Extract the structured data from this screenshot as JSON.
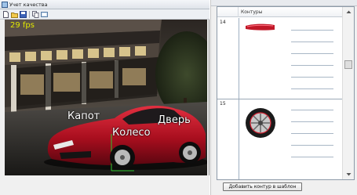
{
  "window": {
    "title": "Учет качества",
    "toolbar": [
      "new-file-icon",
      "open-folder-icon",
      "save-icon",
      "copy-icon",
      "settings-icon"
    ]
  },
  "viewport": {
    "fps": "29 fps",
    "labels": {
      "hood": "Капот",
      "door": "Дверь",
      "wheel": "Колесо"
    }
  },
  "panel": {
    "columns": [
      "",
      "Контуры"
    ],
    "rows": [
      {
        "number": "14",
        "thumbnail": "hood-contour-thumbnail"
      },
      {
        "number": "15",
        "thumbnail": "wheel-contour-thumbnail"
      }
    ],
    "add_button": "Добавить контур в шаблон"
  },
  "colors": {
    "fps_text": "#e2e800",
    "car_body": "#b01020",
    "grid_line": "#a9b7c6"
  }
}
